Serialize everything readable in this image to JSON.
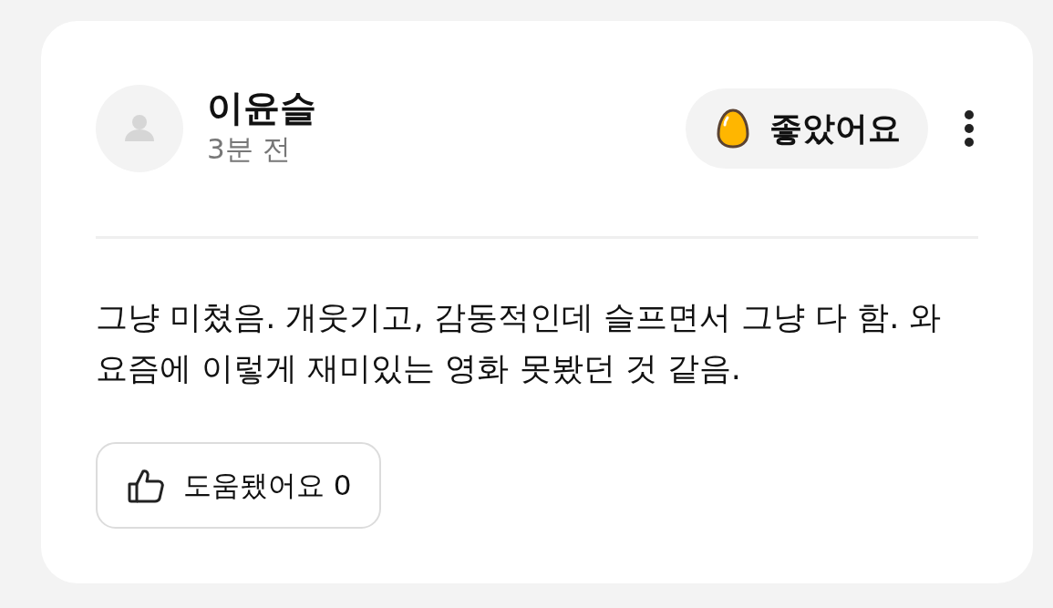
{
  "review": {
    "author": {
      "name": "이윤슬",
      "time": "3분 전"
    },
    "rating": {
      "label": "좋았어요"
    },
    "text": "그냥 미쳤음. 개웃기고, 감동적인데 슬프면서 그냥 다 함. 와 요즘에 이렇게 재미있는 영화 못봤던 것 같음.",
    "helpful": {
      "label": "도움됐어요",
      "count": "0"
    }
  }
}
